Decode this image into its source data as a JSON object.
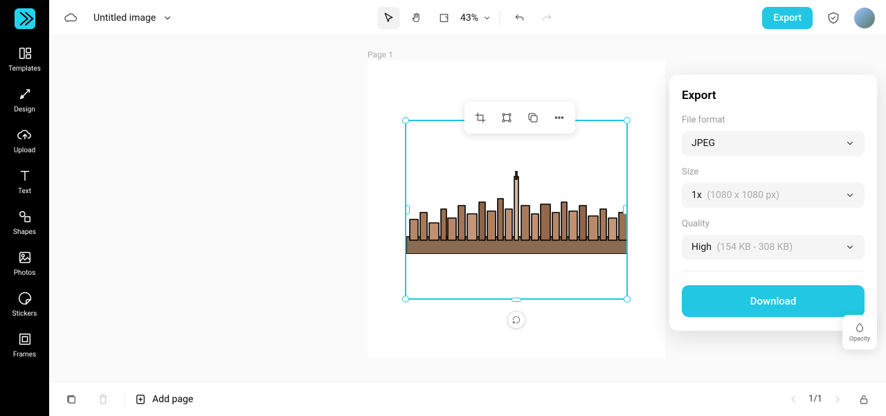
{
  "header": {
    "doc_title": "Untitled image",
    "zoom": "43%",
    "export_label": "Export"
  },
  "left_rail": {
    "templates": "Templates",
    "design": "Design",
    "upload": "Upload",
    "text": "Text",
    "shapes": "Shapes",
    "photos": "Photos",
    "stickers": "Stickers",
    "frames": "Frames"
  },
  "canvas": {
    "page_label": "Page 1"
  },
  "export_panel": {
    "title": "Export",
    "file_format_label": "File format",
    "file_format_value": "JPEG",
    "size_label": "Size",
    "size_prefix": "1x",
    "size_value": "(1080 x 1080 px)",
    "quality_label": "Quality",
    "quality_prefix": "High",
    "quality_value": "(154 KB - 308 KB)",
    "download": "Download"
  },
  "right_tools": {
    "opacity": "Opacity"
  },
  "bottom": {
    "add_page": "Add page",
    "page_indicator": "1/1"
  }
}
